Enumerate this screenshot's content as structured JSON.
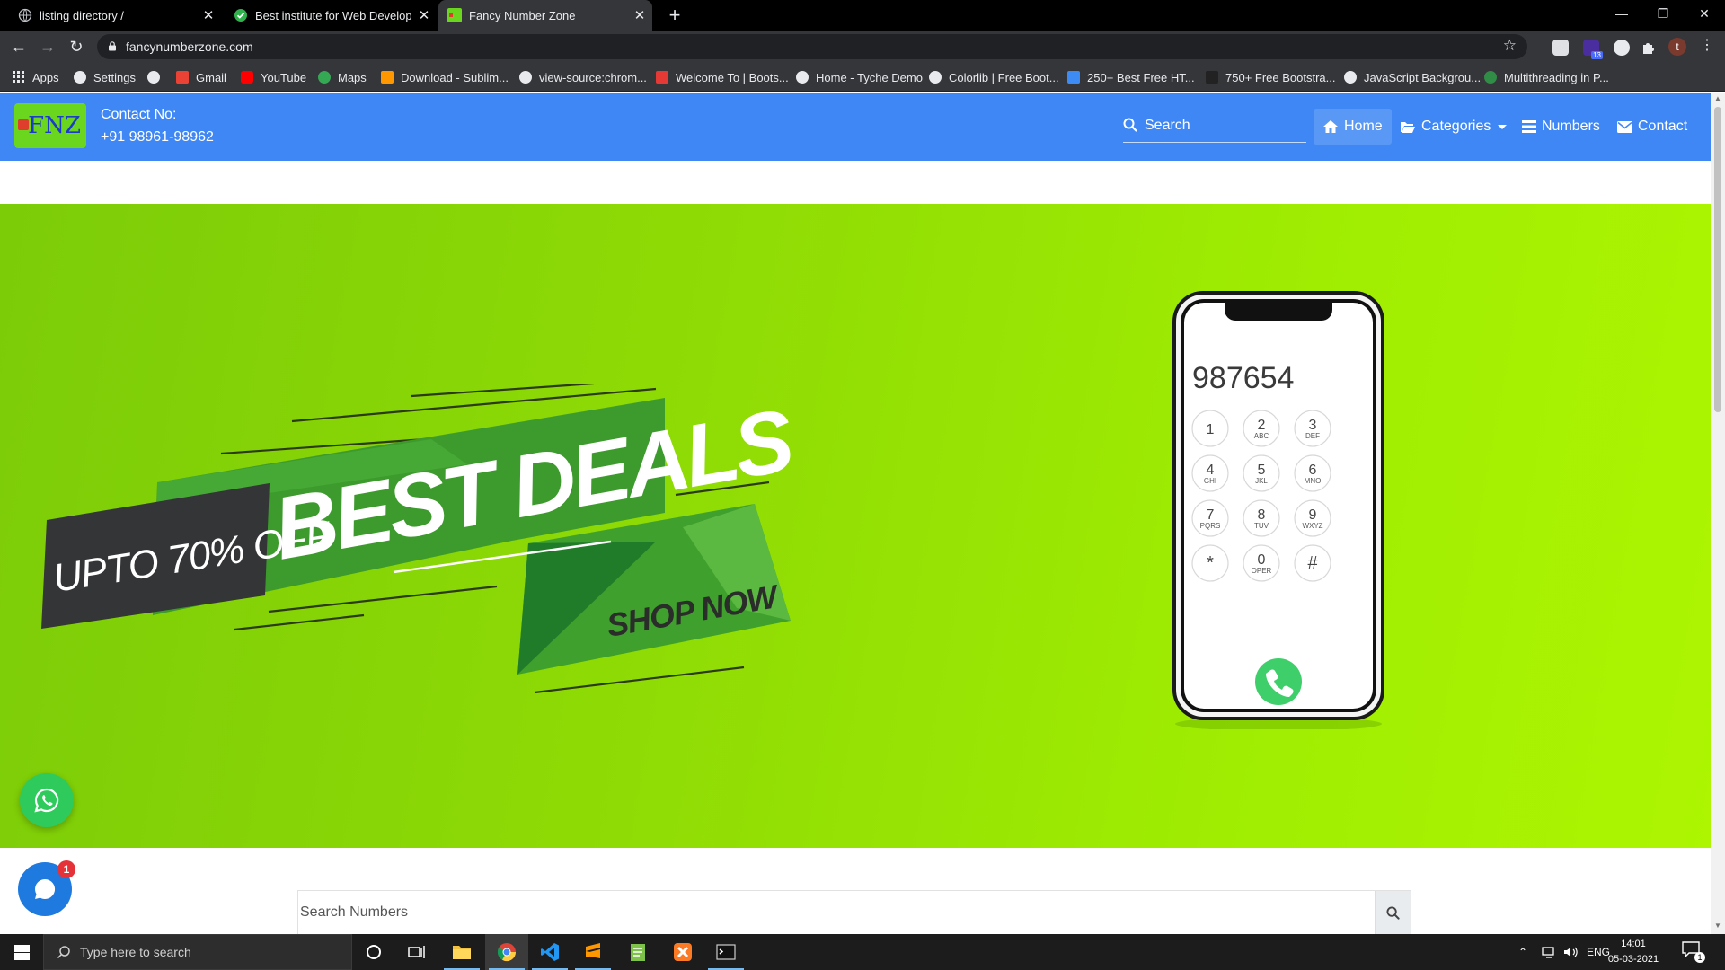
{
  "browser": {
    "tabs": [
      {
        "title": "listing directory /",
        "active": false
      },
      {
        "title": "Best institute for Web Developm",
        "active": false
      },
      {
        "title": "Fancy Number Zone",
        "active": true
      }
    ],
    "url": "fancynumberzone.com",
    "bookmarks": [
      "Apps",
      "Settings",
      "Gmail",
      "YouTube",
      "Maps",
      "Download - Sublim...",
      "view-source:chrom...",
      "Welcome To | Boots...",
      "Home - Tyche Demo",
      "Colorlib | Free Boot...",
      "250+ Best Free HT...",
      "750+ Free Bootstra...",
      "JavaScript Backgrou...",
      "Multithreading in P..."
    ],
    "extension_badge": "13",
    "profile_initial": "t",
    "colors": {
      "frame": "#000000",
      "toolbar": "#35363a",
      "omnibox": "#202124"
    }
  },
  "site": {
    "logo_text": "FNZ",
    "contact_label": "Contact No:",
    "contact_phone": "+91 98961-98962",
    "search_placeholder": "Search",
    "nav": {
      "home": "Home",
      "categories": "Categories",
      "numbers": "Numbers",
      "contact": "Contact"
    },
    "colors": {
      "navbar": "#3e87f5",
      "hero_start": "#7ccc08",
      "hero_end": "#adf501"
    }
  },
  "hero": {
    "upto": "UPTO 70% OFF",
    "headline": "BEST DEALS",
    "cta": "SHOP NOW",
    "phone_display": "987654",
    "keypad": [
      {
        "digit": "1",
        "letters": ""
      },
      {
        "digit": "2",
        "letters": "ABC"
      },
      {
        "digit": "3",
        "letters": "DEF"
      },
      {
        "digit": "4",
        "letters": "GHI"
      },
      {
        "digit": "5",
        "letters": "JKL"
      },
      {
        "digit": "6",
        "letters": "MNO"
      },
      {
        "digit": "7",
        "letters": "PQRS"
      },
      {
        "digit": "8",
        "letters": "TUV"
      },
      {
        "digit": "9",
        "letters": "WXYZ"
      },
      {
        "digit": "*",
        "letters": ""
      },
      {
        "digit": "0",
        "letters": "OPER"
      },
      {
        "digit": "#",
        "letters": ""
      }
    ]
  },
  "number_search": {
    "placeholder": "Search Numbers"
  },
  "chat_badge": "1",
  "taskbar": {
    "search_placeholder": "Type here to search",
    "language": "ENG",
    "time": "14:01",
    "date": "05-03-2021",
    "notification_count": "1"
  }
}
